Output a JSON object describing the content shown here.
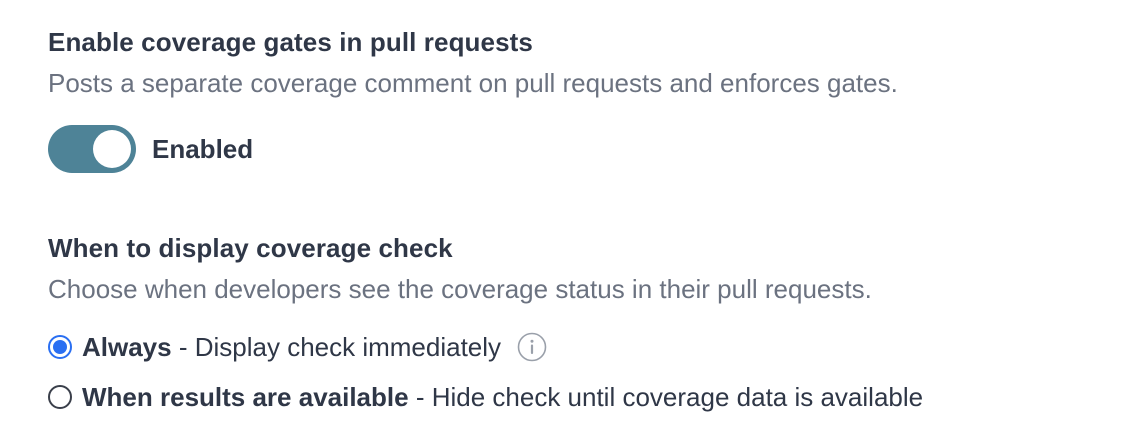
{
  "coverage_gates": {
    "heading": "Enable coverage gates in pull requests",
    "description": "Posts a separate coverage comment on pull requests and enforces gates.",
    "toggle": {
      "state": "on",
      "label": "Enabled",
      "color": "#4e8397"
    }
  },
  "display_check": {
    "heading": "When to display coverage check",
    "description": "Choose when developers see the coverage status in their pull requests.",
    "separator": " - ",
    "options": [
      {
        "title": "Always",
        "description": "Display check immediately",
        "selected": true,
        "icon": "info-icon"
      },
      {
        "title": "When results are available",
        "description": "Hide check until coverage data is available",
        "selected": false
      }
    ],
    "accent_color": "#2a6ff2"
  }
}
